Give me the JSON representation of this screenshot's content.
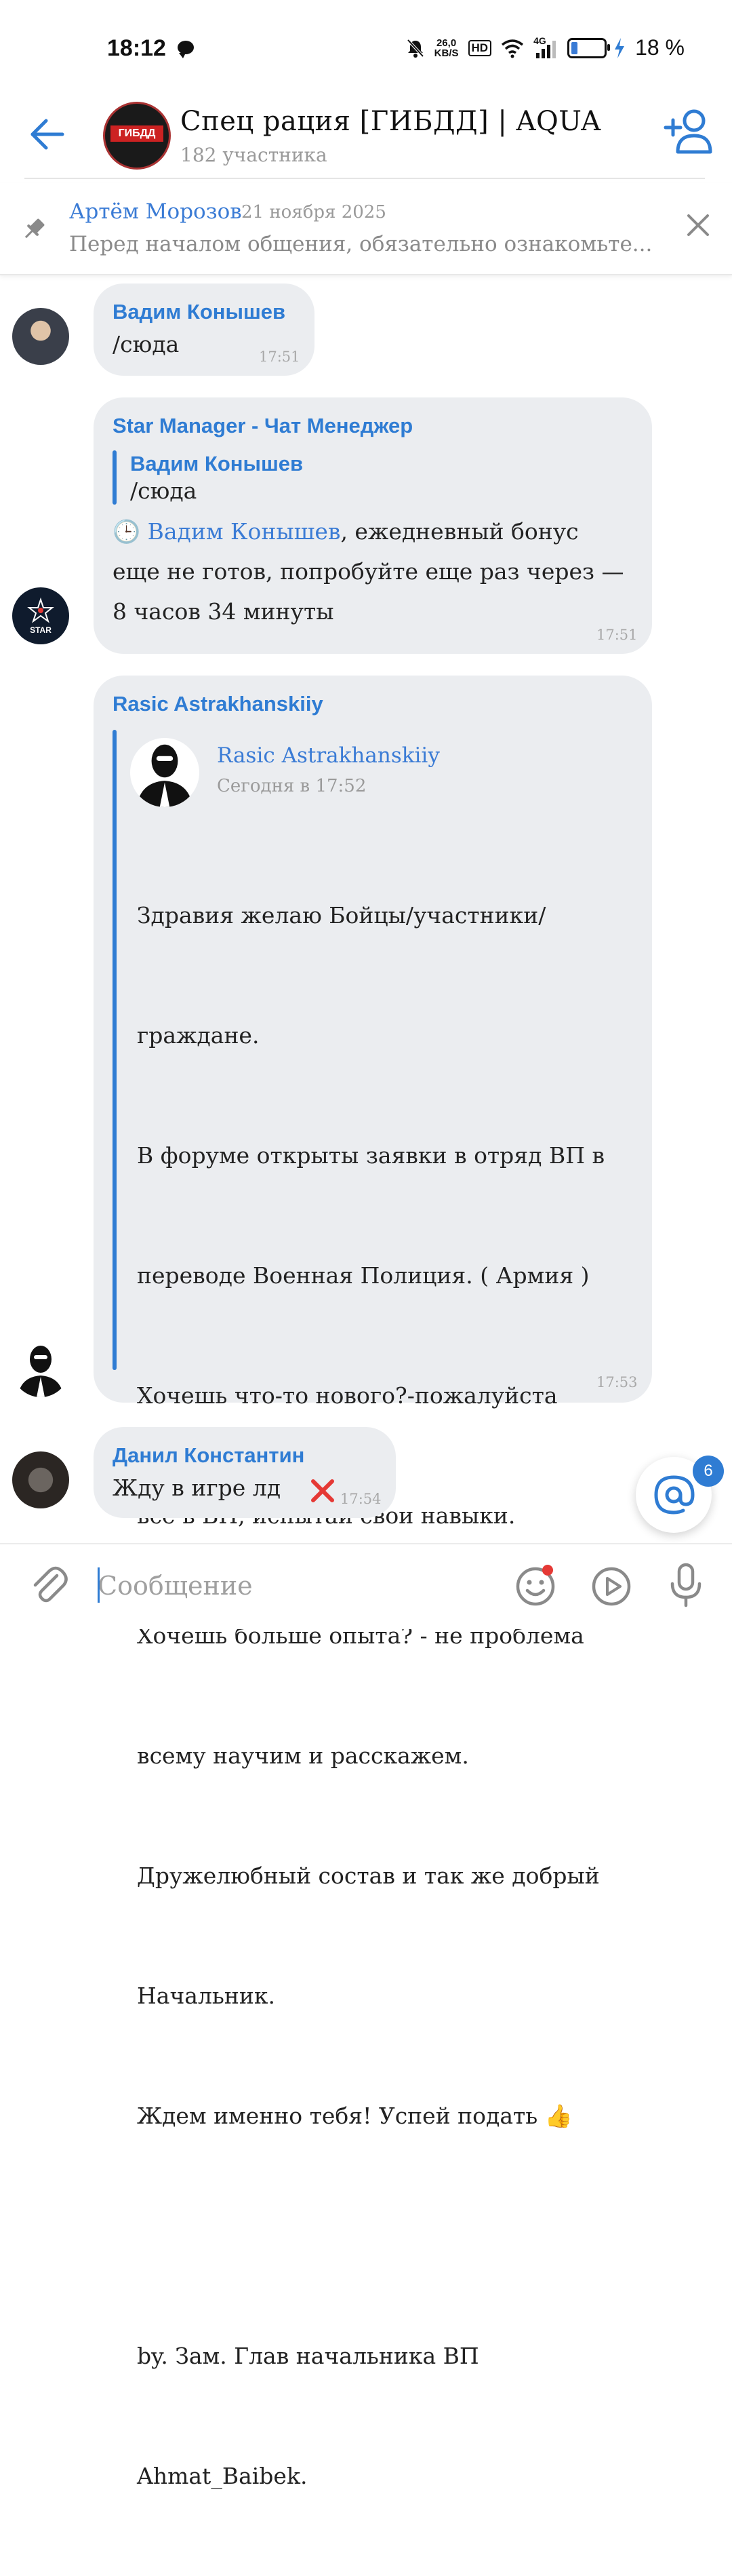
{
  "status_bar": {
    "time": "18:12",
    "speed_value": "26,0",
    "speed_unit": "KB/S",
    "hd": "HD",
    "net": "4G",
    "battery": "18 %"
  },
  "header": {
    "title": "Спец рация [ГИБДД] | AQUA",
    "subtitle": "182 участника",
    "avatar_text": "ГИБДД"
  },
  "pinned": {
    "author": "Артём Морозов",
    "date": "21 ноября 2025",
    "text": "Перед началом общения, обязательно ознакомьте..."
  },
  "messages": [
    {
      "sender": "Вадим Конышев",
      "text": "/сюда",
      "time": "17:51"
    },
    {
      "sender": "Star Manager - Чат Менеджер",
      "reply_sender": "Вадим Конышев",
      "reply_text": "/сюда",
      "clock": "🕒",
      "mention": "Вадим Конышев",
      "text_line1": ", ежедневный бонус",
      "text_line2": "еще не готов, попробуйте еще раз через —",
      "text_line3": "8 часов 34 минуты",
      "time": "17:51",
      "avatar_text": "STAR"
    },
    {
      "sender": "Rasic Astrakhanskiiy",
      "forward_author": "Rasic Astrakhanskiiy",
      "forward_time": "Сегодня в 17:52",
      "lines": [
        "Здравия желаю Бойцы/участники/",
        "граждане.",
        "В форуме открыты заявки в отряд ВП в",
        "переводе Военная Полиция. ( Армия )",
        "Хочешь что-то нового?-пожалуйста",
        "все в ВП, испытай свои навыки.",
        "Хочешь больше опыта? - не проблема",
        "всему научим и расскажем.",
        "Дружелюбный состав и так же добрый",
        "Начальник.",
        "Ждем именно тебя! Успей подать 👍",
        "",
        "by. Зам. Глав начальника ВП",
        "Ahmat_Baibek."
      ],
      "time": "17:53"
    },
    {
      "sender": "Данил Константин",
      "text": "Жду в игре лд",
      "time": "17:54"
    }
  ],
  "mention_badge": "6",
  "input": {
    "placeholder": "Сообщение"
  },
  "colors": {
    "accent": "#2f7cd3",
    "bubble": "#ebedf0",
    "error": "#e53935"
  }
}
